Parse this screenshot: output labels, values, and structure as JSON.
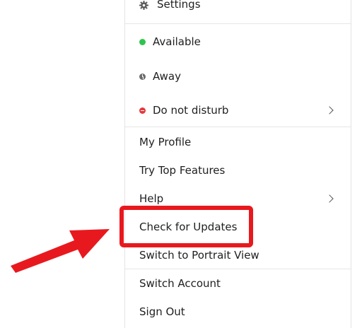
{
  "menu": {
    "settings": "Settings",
    "status": {
      "available": "Available",
      "away": "Away",
      "dnd": "Do not disturb"
    },
    "items": {
      "my_profile": "My Profile",
      "try_top_features": "Try Top Features",
      "help": "Help",
      "check_for_updates": "Check for Updates",
      "switch_portrait": "Switch to Portrait View",
      "switch_account": "Switch Account",
      "sign_out": "Sign Out"
    }
  },
  "colors": {
    "available": "#2fc44f",
    "away": "#6c6c6c",
    "dnd": "#e5383b",
    "annotation": "#e8191e"
  },
  "icons": {
    "settings": "gear-icon",
    "submenu": "chevron-right-icon",
    "annotation": "arrow-icon"
  }
}
